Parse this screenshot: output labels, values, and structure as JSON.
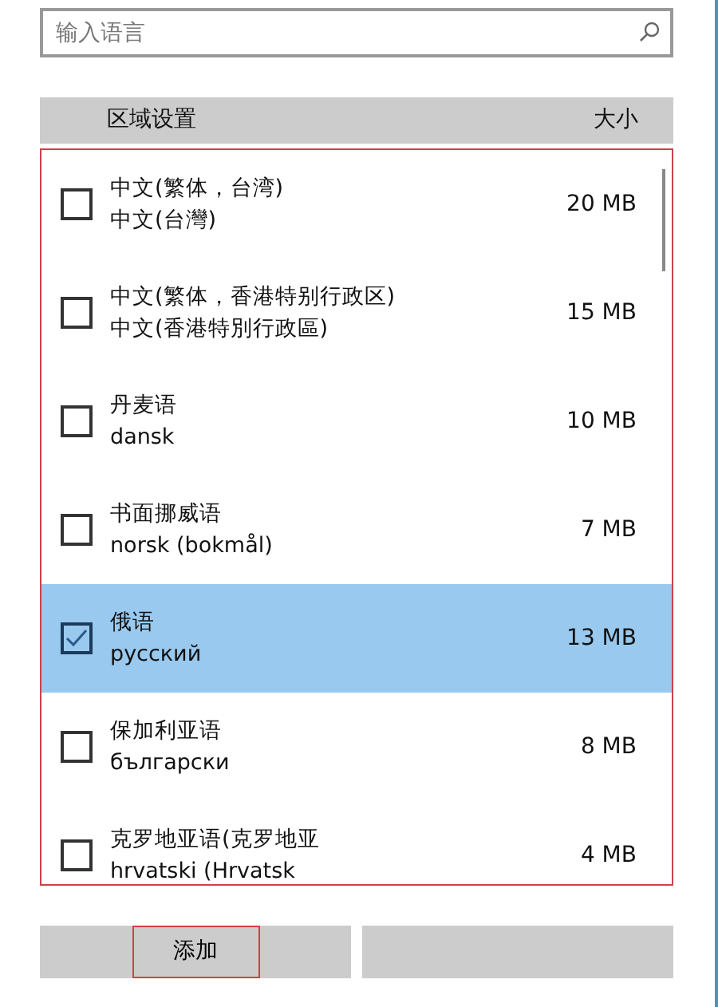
{
  "search": {
    "placeholder": "输入语言"
  },
  "columns": [
    "区域设置",
    "大小"
  ],
  "list": {
    "highlighted": true,
    "rows": [
      {
        "name": "中文(繁体，台湾)",
        "native": "中文(台灣)",
        "size": "20 MB",
        "checked": false,
        "selected": false
      },
      {
        "name": "中文(繁体，香港特别行政区)",
        "native": "中文(香港特別行政區)",
        "size": "15 MB",
        "checked": false,
        "selected": false
      },
      {
        "name": "丹麦语",
        "native": "dansk",
        "size": "10 MB",
        "checked": false,
        "selected": false
      },
      {
        "name": "书面挪威语",
        "native": "norsk (bokmål)",
        "size": "7 MB",
        "checked": false,
        "selected": false
      },
      {
        "name": "俄语",
        "native": "русский",
        "size": "13 MB",
        "checked": true,
        "selected": true
      },
      {
        "name": "保加利亚语",
        "native": "български",
        "size": "8 MB",
        "checked": false,
        "selected": false
      },
      {
        "name": "克罗地亚语(克罗地亚",
        "native": "hrvatski (Hrvatsk",
        "size": "4 MB",
        "checked": false,
        "selected": false
      }
    ]
  },
  "buttons": [
    {
      "label": "添加",
      "highlighted": true
    },
    {
      "highlighted": false
    }
  ]
}
